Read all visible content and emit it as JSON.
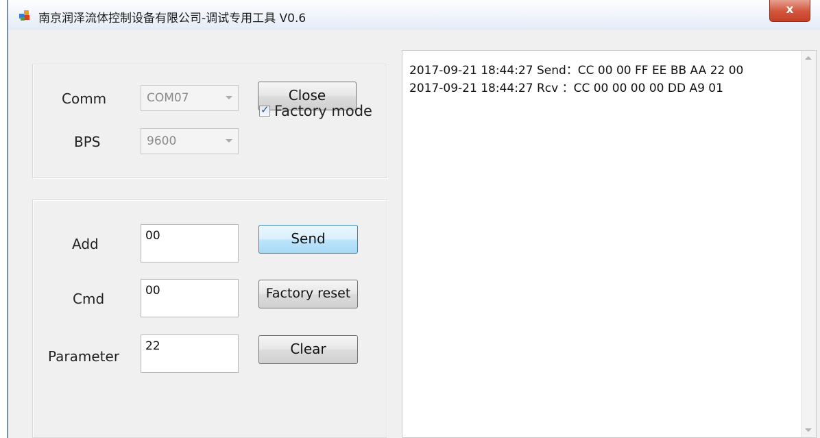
{
  "window": {
    "title": "南京润泽流体控制设备有限公司-调试专用工具 V0.6",
    "close_glyph": "x"
  },
  "serial_group": {
    "comm_label": "Comm",
    "comm_value": "COM07",
    "bps_label": "BPS",
    "bps_value": "9600",
    "close_button": "Close",
    "factory_mode_label": "Factory mode",
    "factory_mode_checked": true
  },
  "command_group": {
    "add_label": "Add",
    "add_value": "00",
    "cmd_label": "Cmd",
    "cmd_value": "00",
    "parameter_label": "Parameter",
    "parameter_value": "22",
    "send_button": "Send",
    "factory_reset_button": "Factory reset",
    "clear_button": "Clear"
  },
  "log": {
    "lines": [
      "2017-09-21 18:44:27 Send：CC 00 00 FF EE BB AA 22 00",
      "2017-09-21 18:44:27 Rcv ：CC 00 00 00 00 DD A9 01"
    ]
  },
  "colors": {
    "window_bg": "#f0f0f0",
    "close_button_red": "#c33f26",
    "focused_button_blue": "#3c7fb1"
  }
}
